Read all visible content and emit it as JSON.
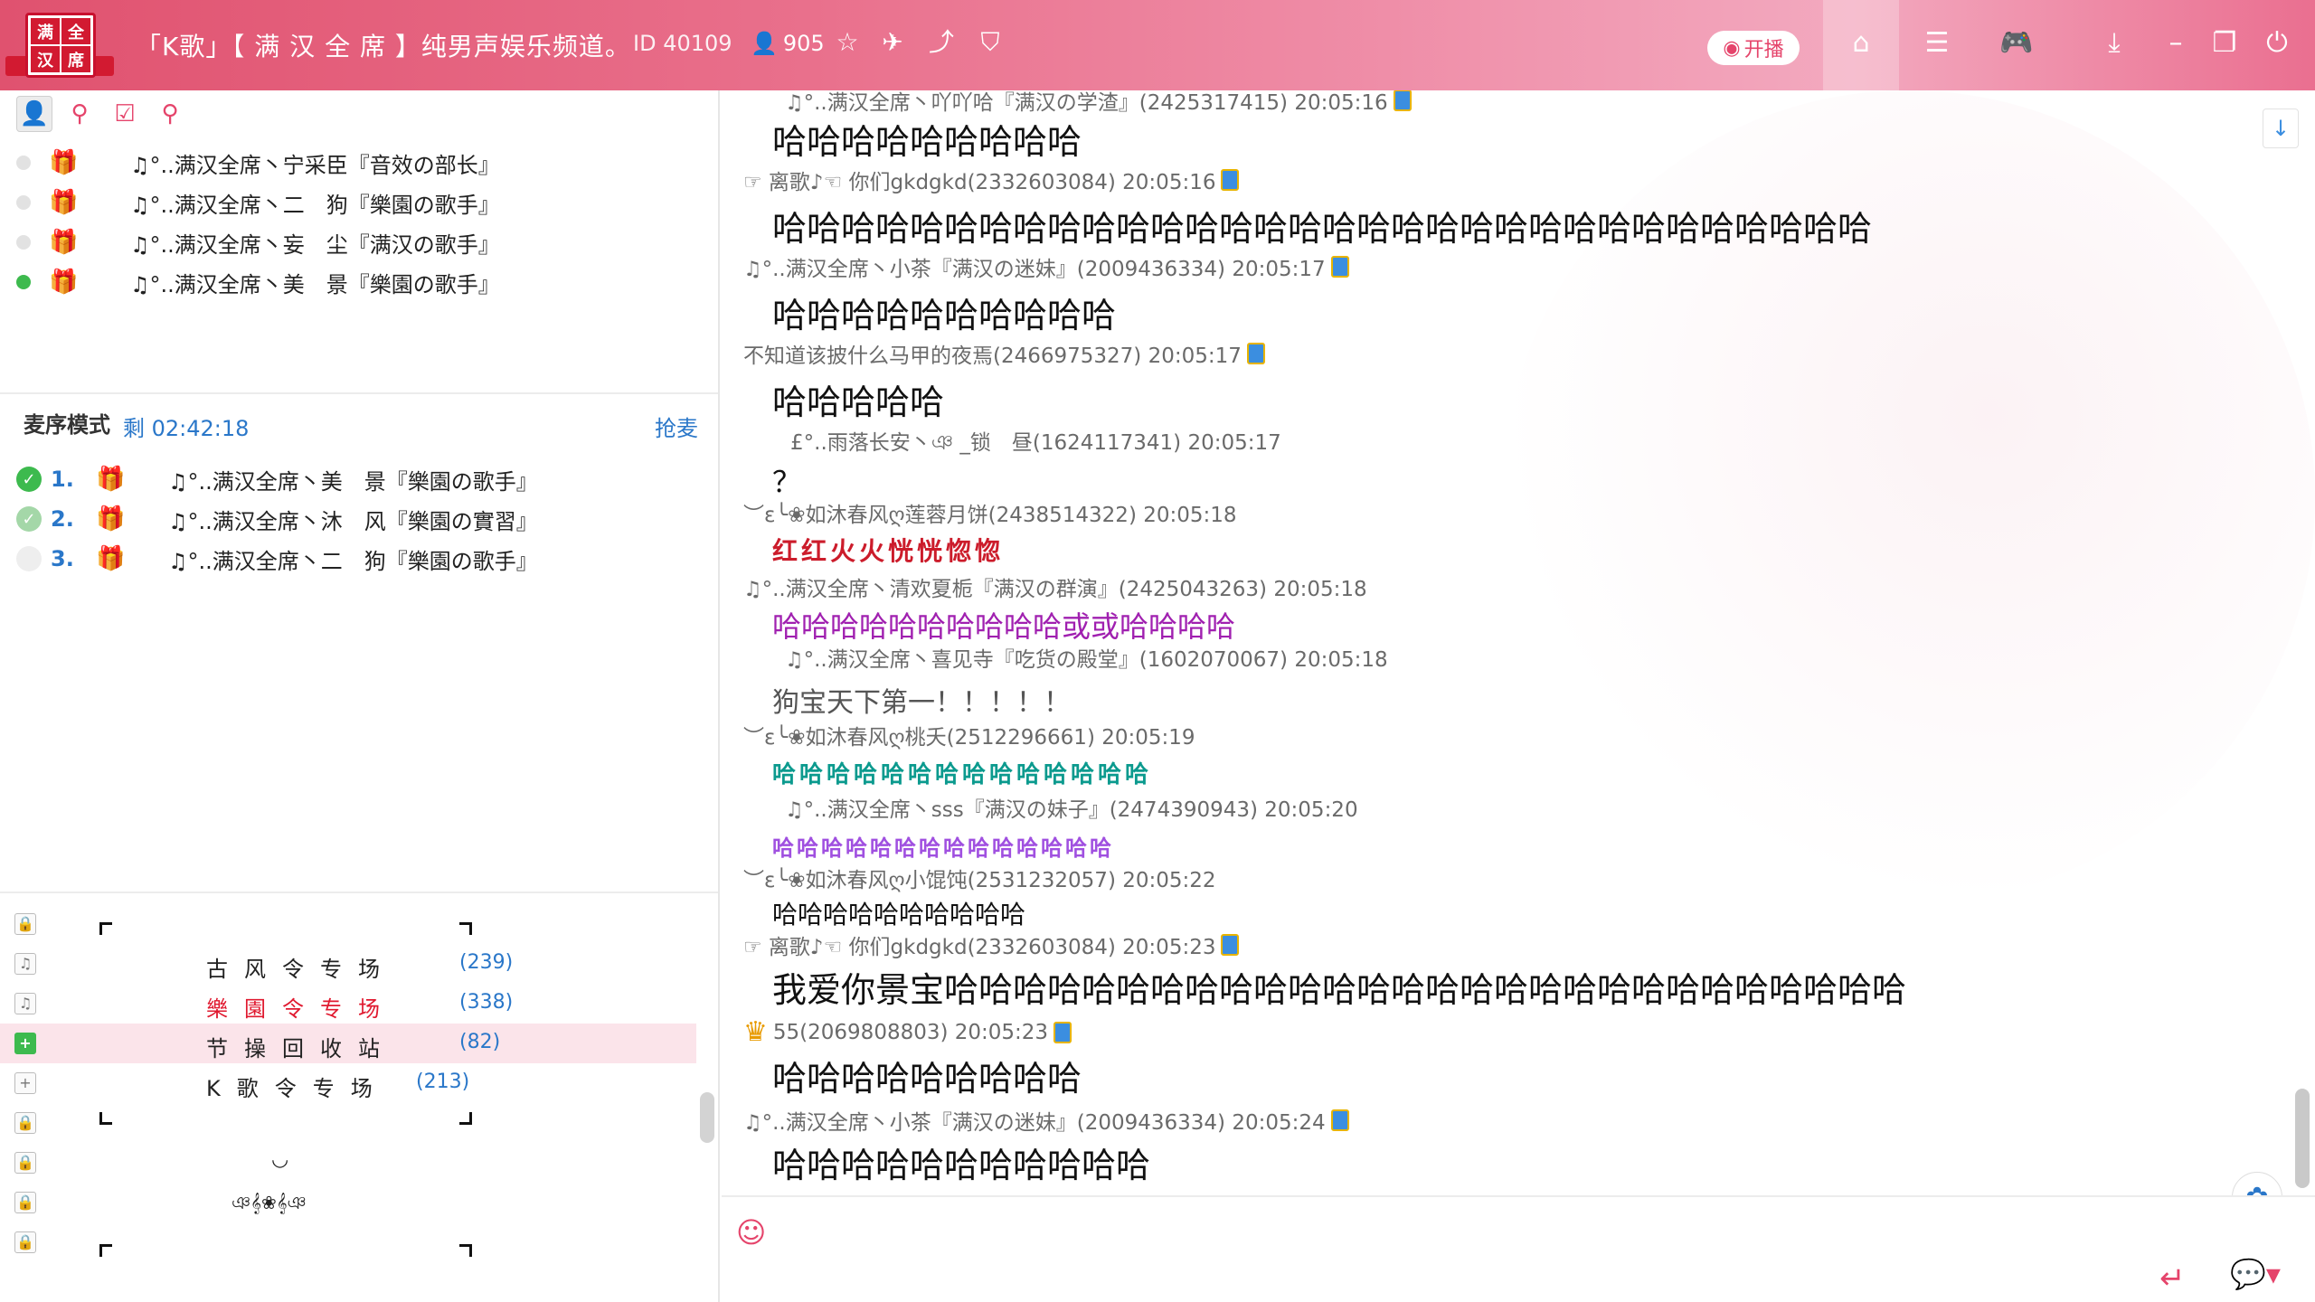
{
  "titlebar": {
    "title": "「K歌」【 满 汉 全 席 】纯男声娱乐频道。",
    "room_id": "ID 40109",
    "user_count": "905",
    "live_label": "开播",
    "logo_chars": [
      "满",
      "全",
      "汉",
      "席"
    ]
  },
  "mic_list": [
    {
      "name": "♫°..满汉全席丶宁采臣『音效の部长』",
      "active": false,
      "gift": "gold"
    },
    {
      "name": "♫°..满汉全席丶二　狗『樂園の歌手』",
      "active": false,
      "gift": "red"
    },
    {
      "name": "♫°..满汉全席丶妄　尘『满汉の歌手』",
      "active": false,
      "gift": "red"
    },
    {
      "name": "♫°..满汉全席丶美　景『樂園の歌手』",
      "active": true,
      "gift": "red"
    }
  ],
  "queue": {
    "mode_label": "麦序模式",
    "remaining": "剩 02:42:18",
    "grab_label": "抢麦",
    "items": [
      {
        "num": "1.",
        "name": "♫°..满汉全席丶美　景『樂園の歌手』",
        "state": "on",
        "gift": "red"
      },
      {
        "num": "2.",
        "name": "♫°..满汉全席丶沐　风『樂園の實習』",
        "state": "on2",
        "gift": "blue"
      },
      {
        "num": "3.",
        "name": "♫°..满汉全席丶二　狗『樂園の歌手』",
        "state": "off",
        "gift": "red"
      }
    ]
  },
  "channels": [
    {
      "name": "古风令专场",
      "count": "(239)",
      "lead": "♫",
      "style": "normal"
    },
    {
      "name": "樂園令专场",
      "count": "(338)",
      "lead": "♫",
      "style": "red"
    },
    {
      "name": "节操回收站",
      "count": "(82)",
      "lead": "+",
      "style": "selected"
    },
    {
      "name": "K歌令专场",
      "count": "(213)",
      "lead": "+",
      "style": "normal"
    }
  ],
  "channel_extras": {
    "smile": "◡",
    "deco": "ঞ𝄞❀𝄞ঞ"
  },
  "messages": [
    {
      "head": "♫°..满汉全席丶吖吖哈『满汉の学渣』(2425317415) 20:05:16",
      "body": "哈哈哈哈哈哈哈哈哈"
    },
    {
      "head": "☞ 离歌♪☜ 你们gkdgkd(2332603084) 20:05:16",
      "body": "哈哈哈哈哈哈哈哈哈哈哈哈哈哈哈哈哈哈哈哈哈哈哈哈哈哈哈哈哈哈哈哈"
    },
    {
      "head": "♫°..满汉全席丶小茶『满汉の迷妹』(2009436334) 20:05:17",
      "body": "哈哈哈哈哈哈哈哈哈哈"
    },
    {
      "head": "不知道该披什么马甲的夜焉(2466975327) 20:05:17",
      "body": "哈哈哈哈哈"
    },
    {
      "head": "£°..雨落长安丶ঞ _锁　昼(1624117341) 20:05:17",
      "body": "？"
    },
    {
      "head": "︶ε╰❀如沐春风ღ莲蓉月饼(2438514322) 20:05:18",
      "body": "红红火火恍恍惚惚"
    },
    {
      "head": "♫°..满汉全席丶清欢夏栀『满汉の群演』(2425043263) 20:05:18",
      "body": "哈哈哈哈哈哈哈哈哈哈或或哈哈哈哈"
    },
    {
      "head": "♫°..满汉全席丶喜见寺『吃货の殿堂』(1602070067) 20:05:18",
      "body": "狗宝天下第一！！！！！"
    },
    {
      "head": "︶ε╰❀如沐春风ღ桃夭(2512296661) 20:05:19",
      "body": "哈哈哈哈哈哈哈哈哈哈哈哈哈哈"
    },
    {
      "head": "♫°..满汉全席丶sss『满汉の妹子』(2474390943) 20:05:20",
      "body": "哈哈哈哈哈哈哈哈哈哈哈哈哈哈"
    },
    {
      "head": "︶ε╰❀如沐春风ღ小馄饨(2531232057) 20:05:22",
      "body": "哈哈哈哈哈哈哈哈哈哈"
    },
    {
      "head": "☞ 离歌♪☜ 你们gkdgkd(2332603084) 20:05:23",
      "body": "我爱你景宝哈哈哈哈哈哈哈哈哈哈哈哈哈哈哈哈哈哈哈哈哈哈哈哈哈哈哈哈"
    },
    {
      "head": "55(2069808803) 20:05:23",
      "body": "哈哈哈哈哈哈哈哈哈"
    },
    {
      "head": "♫°..满汉全席丶小茶『满汉の迷妹』(2009436334) 20:05:24",
      "body": "哈哈哈哈哈哈哈哈哈哈哈"
    }
  ],
  "input": {
    "placeholder": ""
  },
  "colors": {
    "accent": "#e5446b",
    "link": "#2a77c9",
    "online": "#3dba4e"
  }
}
